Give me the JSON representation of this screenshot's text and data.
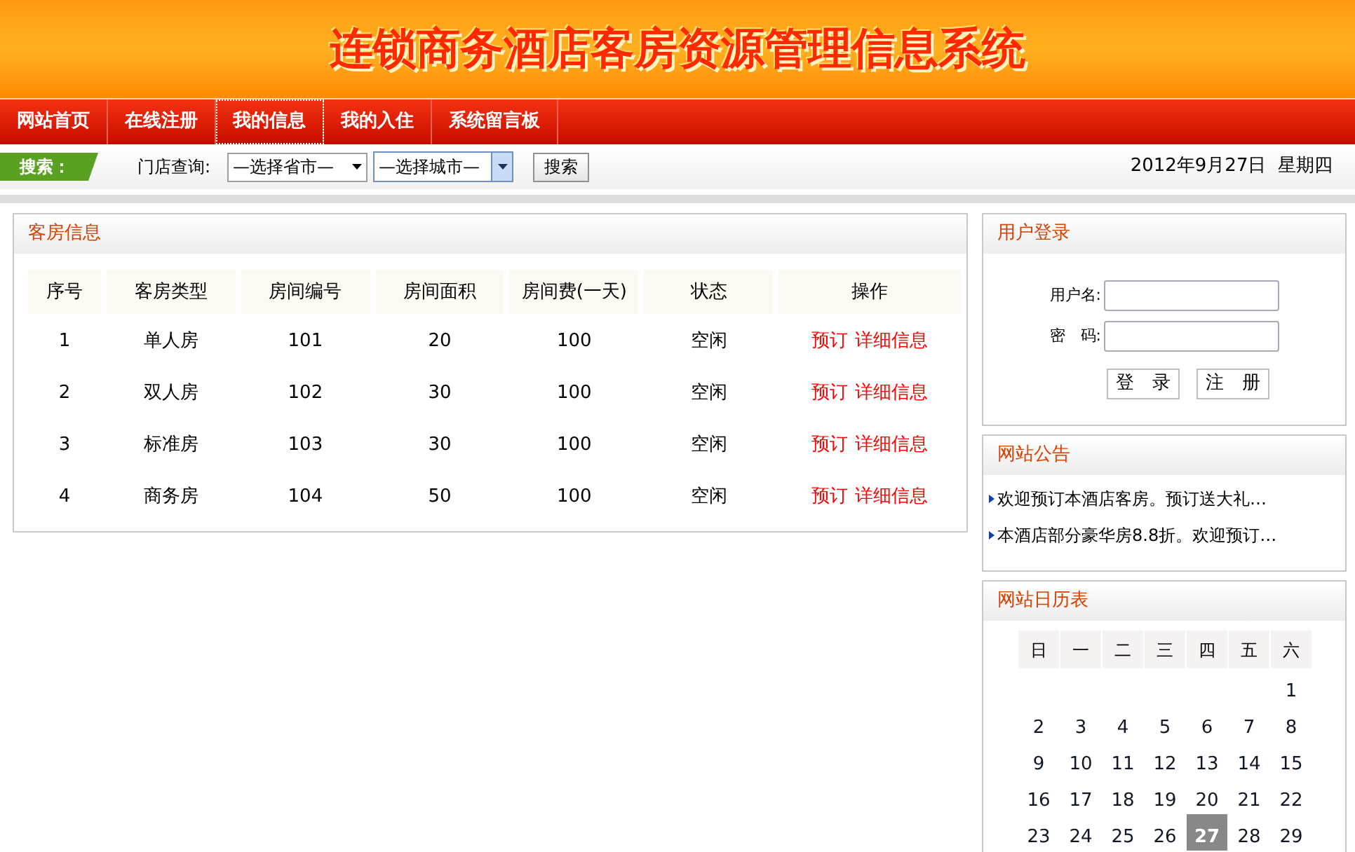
{
  "banner": {
    "title": "连锁商务酒店客房资源管理信息系统"
  },
  "nav": [
    {
      "label": "网站首页",
      "focused": false
    },
    {
      "label": "在线注册",
      "focused": false
    },
    {
      "label": "我的信息",
      "focused": true
    },
    {
      "label": "我的入住",
      "focused": false
    },
    {
      "label": "系统留言板",
      "focused": false
    }
  ],
  "search_bar": {
    "tag": "搜索：",
    "store_label": "门店查询:",
    "province_select": "—选择省市—",
    "city_select": "—选择城市—",
    "button": "搜索",
    "date": "2012年9月27日  星期四"
  },
  "rooms": {
    "title": "客房信息",
    "columns": [
      "序号",
      "客房类型",
      "房间编号",
      "房间面积",
      "房间费(一天)",
      "状态",
      "操作"
    ],
    "rows": [
      {
        "no": "1",
        "type": "单人房",
        "room": "101",
        "area": "20",
        "fee": "100",
        "status": "空闲",
        "actions": [
          "预订",
          "详细信息"
        ]
      },
      {
        "no": "2",
        "type": "双人房",
        "room": "102",
        "area": "30",
        "fee": "100",
        "status": "空闲",
        "actions": [
          "预订",
          "详细信息"
        ]
      },
      {
        "no": "3",
        "type": "标准房",
        "room": "103",
        "area": "30",
        "fee": "100",
        "status": "空闲",
        "actions": [
          "预订",
          "详细信息"
        ]
      },
      {
        "no": "4",
        "type": "商务房",
        "room": "104",
        "area": "50",
        "fee": "100",
        "status": "空闲",
        "actions": [
          "预订",
          "详细信息"
        ]
      }
    ]
  },
  "login": {
    "title": "用户登录",
    "username_label": "用户名:",
    "password_label": "密　码:",
    "buttons": [
      "登　录",
      "注　册"
    ]
  },
  "notices": {
    "title": "网站公告",
    "items": [
      "欢迎预订本酒店客房。预订送大礼…",
      "本酒店部分豪华房8.8折。欢迎预订…"
    ]
  },
  "calendar": {
    "title": "网站日历表",
    "weekdays": [
      "日",
      "一",
      "二",
      "三",
      "四",
      "五",
      "六"
    ],
    "weeks": [
      [
        {
          "kind": "blank"
        },
        {
          "kind": "blank"
        },
        {
          "kind": "blank"
        },
        {
          "kind": "blank"
        },
        {
          "kind": "blank"
        },
        {
          "kind": "blank"
        },
        {
          "kind": "day",
          "day": "1",
          "selected": false
        }
      ],
      [
        {
          "day": "2",
          "selected": false
        },
        {
          "day": "3",
          "selected": false
        },
        {
          "day": "4",
          "selected": false
        },
        {
          "day": "5",
          "selected": false
        },
        {
          "day": "6",
          "selected": false
        },
        {
          "day": "7",
          "selected": false
        },
        {
          "day": "8",
          "selected": false
        }
      ],
      [
        {
          "day": "9",
          "selected": false
        },
        {
          "day": "10",
          "selected": false
        },
        {
          "day": "11",
          "selected": false
        },
        {
          "day": "12",
          "selected": false
        },
        {
          "day": "13",
          "selected": false
        },
        {
          "day": "14",
          "selected": false
        },
        {
          "day": "15",
          "selected": false
        }
      ],
      [
        {
          "day": "16",
          "selected": false
        },
        {
          "day": "17",
          "selected": false
        },
        {
          "day": "18",
          "selected": false
        },
        {
          "day": "19",
          "selected": false
        },
        {
          "day": "20",
          "selected": false
        },
        {
          "day": "21",
          "selected": false
        },
        {
          "day": "22",
          "selected": false
        }
      ],
      [
        {
          "day": "23",
          "selected": false
        },
        {
          "day": "24",
          "selected": false
        },
        {
          "day": "25",
          "selected": false
        },
        {
          "day": "26",
          "selected": false
        },
        {
          "day": "27",
          "selected": true
        },
        {
          "day": "28",
          "selected": false
        },
        {
          "day": "29",
          "selected": false
        }
      ]
    ]
  }
}
